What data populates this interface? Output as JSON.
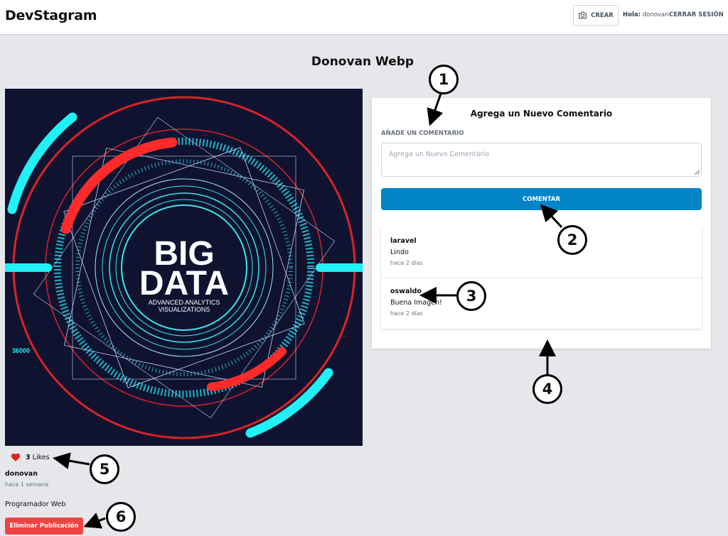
{
  "header": {
    "brand": "DevStagram",
    "crear_label": "CREAR",
    "hola_label": "Hola:",
    "username": "donovan",
    "logout_label": "CERRAR SESIÓN"
  },
  "page_title": "Donovan Webp",
  "image": {
    "big": "BIG",
    "data": "DATA",
    "sub1": "ADVANCED ANALYTICS",
    "sub2": "VISUALIZATIONS",
    "number": "36000"
  },
  "comment_form": {
    "title": "Agrega un Nuevo Comentario",
    "label": "Añade un Comentario",
    "placeholder": "Agrega un Nuevo Comentario",
    "button": "COMENTAR"
  },
  "comments": [
    {
      "user": "laravel",
      "text": "Lindo",
      "date": "hace 2 días"
    },
    {
      "user": "oswaldo",
      "text": "Buena Imagen!",
      "date": "hace 2 días"
    }
  ],
  "post": {
    "likes_count": "3",
    "likes_label": "Likes",
    "author": "donovan",
    "time": "hace 1 semana",
    "description": "Programador Web",
    "delete_button": "Eliminar Publicación"
  },
  "annotations": [
    "1",
    "2",
    "3",
    "4",
    "5",
    "6"
  ],
  "colors": {
    "comment_button": "#0284c7",
    "delete_button": "#ef4444",
    "heart": "#dc2626"
  }
}
